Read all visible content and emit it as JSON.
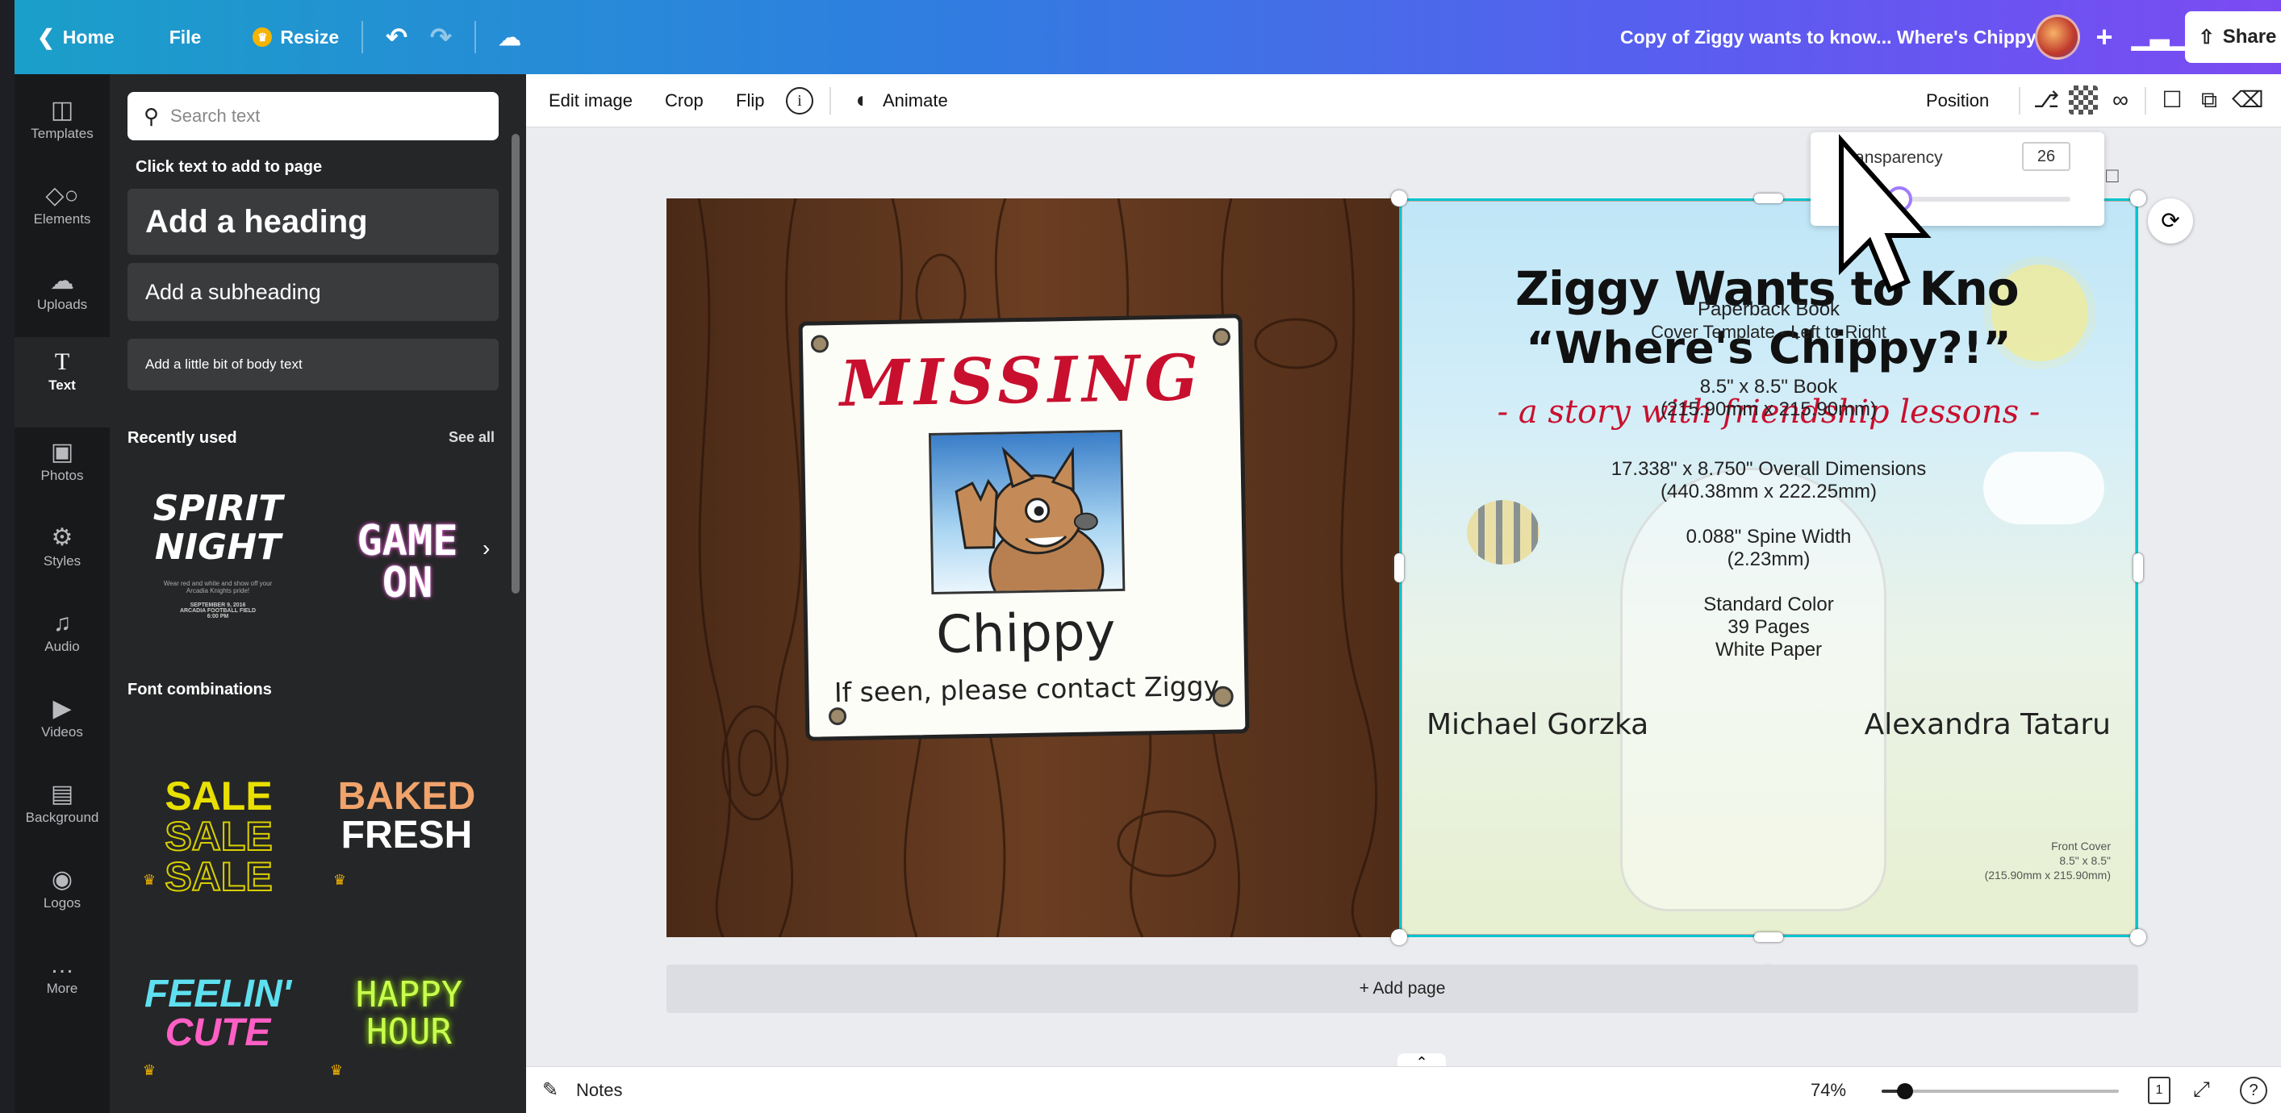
{
  "topbar": {
    "home": "Home",
    "file": "File",
    "resize": "Resize",
    "doc_title": "Copy of Ziggy wants to know... Where's Chippy?",
    "share": "Share"
  },
  "rail": {
    "items": [
      {
        "label": "Templates",
        "icon": "templates-icon"
      },
      {
        "label": "Elements",
        "icon": "elements-icon"
      },
      {
        "label": "Uploads",
        "icon": "uploads-icon"
      },
      {
        "label": "Text",
        "icon": "text-icon"
      },
      {
        "label": "Photos",
        "icon": "photos-icon"
      },
      {
        "label": "Styles",
        "icon": "styles-icon"
      },
      {
        "label": "Audio",
        "icon": "audio-icon"
      },
      {
        "label": "Videos",
        "icon": "videos-icon"
      },
      {
        "label": "Background",
        "icon": "background-icon"
      },
      {
        "label": "Logos",
        "icon": "logos-icon"
      },
      {
        "label": "More",
        "icon": "more-icon"
      }
    ]
  },
  "panel": {
    "search_placeholder": "Search text",
    "click_to_add": "Click text to add to page",
    "add_heading": "Add a heading",
    "add_subheading": "Add a subheading",
    "add_body": "Add a little bit of body text",
    "recently_used": "Recently used",
    "see_all": "See all",
    "font_combinations": "Font combinations",
    "tiles": {
      "spirit_line1": "SPIRIT",
      "spirit_line2": "NIGHT",
      "spirit_small": "Wear red and white and show off your Arcadia Knights pride!",
      "spirit_date": "SEPTEMBER 9, 2016",
      "spirit_place": "ARCADIA FOOTBALL FIELD",
      "spirit_time": "6:00 PM",
      "game_line1": "GAME",
      "game_line2": "ON",
      "sale": "SALE",
      "baked_line1": "BAKED",
      "baked_line2": "FRESH",
      "feelin_line1": "FEELIN'",
      "feelin_line2": "CUTE",
      "happy_line1": "HAPPY",
      "happy_line2": "HOUR"
    }
  },
  "context_toolbar": {
    "edit_image": "Edit image",
    "crop": "Crop",
    "flip": "Flip",
    "animate": "Animate",
    "position": "Position"
  },
  "transparency": {
    "label": "Transparency",
    "value": "26",
    "level_percent": 26
  },
  "canvas": {
    "poster_title": "MISSING",
    "poster_name": "Chippy",
    "poster_contact": "If seen, please contact Ziggy",
    "cover_title_line1": "Ziggy Wants to Kno",
    "cover_title_line2": "“Where's Chippy?!”",
    "cover_subtitle": "- a story with friendship lessons -",
    "template_line1": "Paperback Book",
    "template_line2": "Cover Template - Left to Right",
    "template_line3": "8.5\" x 8.5\" Book",
    "template_line4": "(215.90mm x 215.90mm)",
    "template_line5": "17.338\" x 8.750\" Overall Dimensions",
    "template_line6": "(440.38mm x 222.25mm)",
    "template_line7": "0.088\" Spine Width",
    "template_line8": "(2.23mm)",
    "template_line9": "Standard Color",
    "template_line10": "39 Pages",
    "template_line11": "White Paper",
    "author": "Michael Gorzka",
    "illustrator": "Alexandra Tataru",
    "front_cover_line1": "Front Cover",
    "front_cover_line2": "8.5\" x 8.5\"",
    "front_cover_line3": "(215.90mm x 215.90mm)",
    "add_page": "+ Add page"
  },
  "bottombar": {
    "notes": "Notes",
    "zoom": "74%",
    "zoom_fraction": 0.1,
    "page_num": "1"
  },
  "colors": {
    "accent": "#8b3dff",
    "selection": "#00c4cc",
    "missing_red": "#c8102e"
  }
}
